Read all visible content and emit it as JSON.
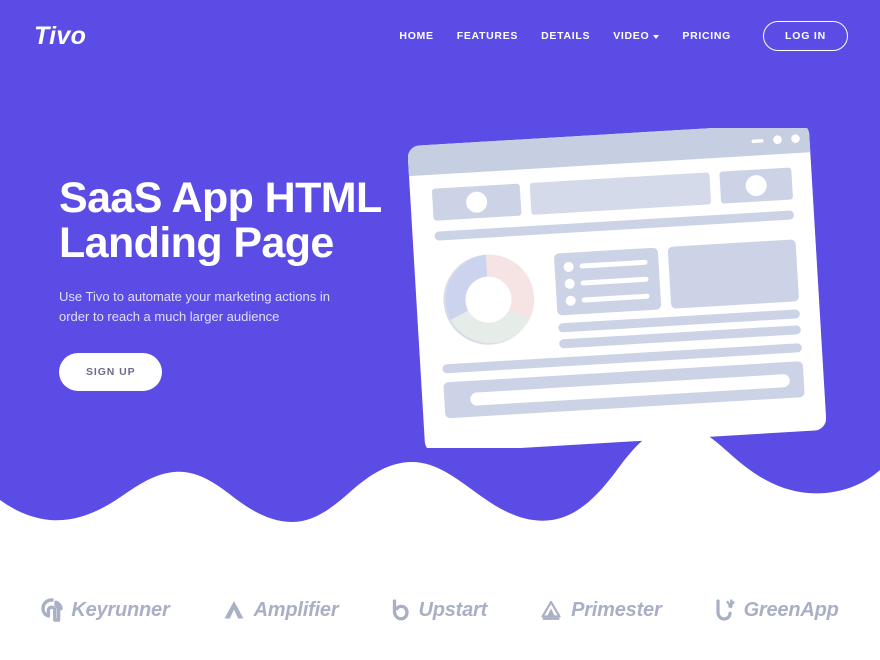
{
  "brand": {
    "logo_text": "Tivo"
  },
  "colors": {
    "purple": "#5B4CE6",
    "purple_dark": "#4b3ad6",
    "white": "#ffffff",
    "subtitle": "#e2ddfb",
    "mockup_gray": "#ccd3e6",
    "mockup_gray_light": "#dbe1ef",
    "brand_gray": "#a9b0c6",
    "signup_text": "#6b6b8d",
    "donut_pink": "#f6e4e4",
    "donut_blue": "#ccd3ef",
    "donut_mint": "#e6ece7",
    "donut_gray": "#d9dce8"
  },
  "nav": {
    "items": [
      {
        "label": "HOME",
        "has_caret": false
      },
      {
        "label": "FEATURES",
        "has_caret": false
      },
      {
        "label": "DETAILS",
        "has_caret": false
      },
      {
        "label": "VIDEO",
        "has_caret": true
      },
      {
        "label": "PRICING",
        "has_caret": false
      }
    ],
    "login_label": "LOG IN"
  },
  "hero": {
    "title_line1": "SaaS App HTML",
    "title_line2": "Landing Page",
    "subtitle": "Use Tivo to automate your marketing actions in order to reach a much larger audience",
    "cta_label": "SIGN UP"
  },
  "mockup": {
    "window_controls": [
      "minimize-dash",
      "dot",
      "dot"
    ],
    "description": "tilted browser window wireframe with donut chart, list block, card and text bars"
  },
  "partners": [
    {
      "name": "Keyrunner",
      "icon": "keyrunner-icon"
    },
    {
      "name": "Amplifier",
      "icon": "amplifier-triangle-icon"
    },
    {
      "name": "Upstart",
      "icon": "upstart-icon"
    },
    {
      "name": "Primester",
      "icon": "primester-icon"
    },
    {
      "name": "GreenApp",
      "icon": "greenapp-icon"
    }
  ]
}
